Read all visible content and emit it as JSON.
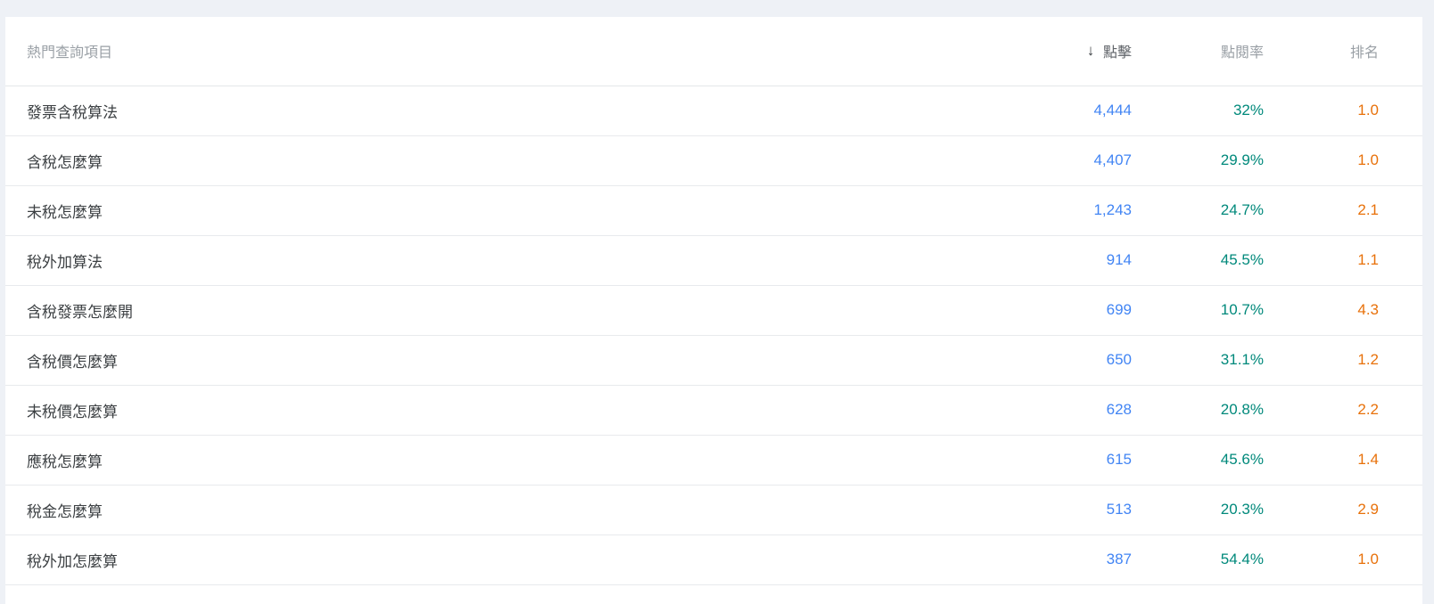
{
  "table": {
    "columns": [
      {
        "key": "query",
        "label": "熱門查詢項目",
        "align": "left"
      },
      {
        "key": "clicks",
        "label": "點擊",
        "align": "right",
        "sorted": true,
        "sort_icon": "arrow-down-icon",
        "sort_glyph": "↓"
      },
      {
        "key": "ctr",
        "label": "點閱率",
        "align": "right"
      },
      {
        "key": "pos",
        "label": "排名",
        "align": "right"
      }
    ],
    "rows": [
      {
        "query": "發票含稅算法",
        "clicks": "4,444",
        "ctr": "32%",
        "pos": "1.0"
      },
      {
        "query": "含稅怎麼算",
        "clicks": "4,407",
        "ctr": "29.9%",
        "pos": "1.0"
      },
      {
        "query": "未稅怎麼算",
        "clicks": "1,243",
        "ctr": "24.7%",
        "pos": "2.1"
      },
      {
        "query": "稅外加算法",
        "clicks": "914",
        "ctr": "45.5%",
        "pos": "1.1"
      },
      {
        "query": "含稅發票怎麼開",
        "clicks": "699",
        "ctr": "10.7%",
        "pos": "4.3"
      },
      {
        "query": "含稅價怎麼算",
        "clicks": "650",
        "ctr": "31.1%",
        "pos": "1.2"
      },
      {
        "query": "未稅價怎麼算",
        "clicks": "628",
        "ctr": "20.8%",
        "pos": "2.2"
      },
      {
        "query": "應稅怎麼算",
        "clicks": "615",
        "ctr": "45.6%",
        "pos": "1.4"
      },
      {
        "query": "稅金怎麼算",
        "clicks": "513",
        "ctr": "20.3%",
        "pos": "2.9"
      },
      {
        "query": "稅外加怎麼算",
        "clicks": "387",
        "ctr": "54.4%",
        "pos": "1.0"
      }
    ]
  },
  "colors": {
    "page_background": "#eef1f6",
    "card_background": "#ffffff",
    "header_text": "#9aa0a6",
    "query_text": "#3c4043",
    "clicks_value": "#4285f4",
    "ctr_value": "#00897b",
    "position_value": "#e8710a",
    "row_divider": "#e8eaed"
  }
}
